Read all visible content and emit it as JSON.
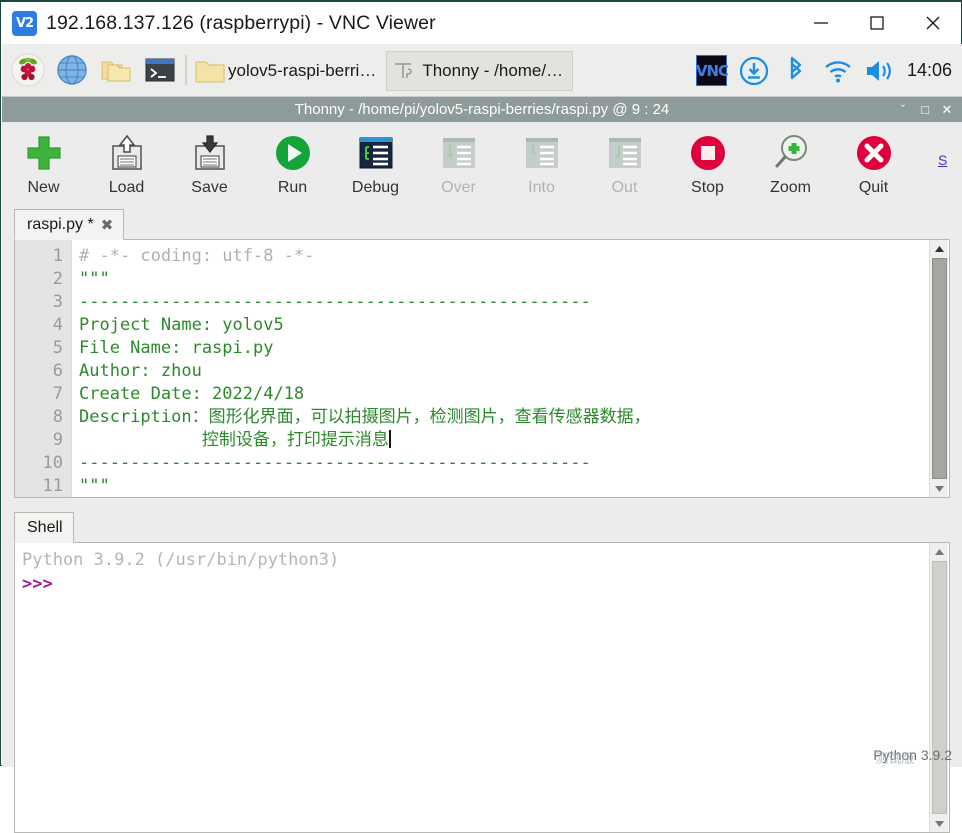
{
  "vnc": {
    "logo_text": "V2",
    "title": "192.168.137.126 (raspberrypi) - VNC Viewer",
    "window_buttons": [
      {
        "name": "minimize",
        "glyph": "—"
      },
      {
        "name": "maximize",
        "glyph": "□"
      },
      {
        "name": "close",
        "glyph": "✕"
      }
    ]
  },
  "taskbar": {
    "launchers": [
      {
        "name": "raspberry-menu-icon",
        "label": "Raspberry Pi Menu"
      },
      {
        "name": "web-browser-icon",
        "label": "Web Browser"
      },
      {
        "name": "file-manager-icon",
        "label": "File Manager"
      },
      {
        "name": "terminal-icon",
        "label": "Terminal"
      }
    ],
    "tasks": [
      {
        "name": "task-file-manager",
        "label": "yolov5-raspi-berri…",
        "icon": "folder-icon",
        "active": false
      },
      {
        "name": "task-thonny",
        "label": "Thonny  -  /home/…",
        "icon": "thonny-icon",
        "active": true
      }
    ],
    "tray": [
      {
        "name": "vnc-server-icon",
        "label": "VNC Server",
        "text": "VNC"
      },
      {
        "name": "update-icon",
        "label": "Updates Available"
      },
      {
        "name": "bluetooth-icon",
        "label": "Bluetooth"
      },
      {
        "name": "wifi-icon",
        "label": "Wireless Network"
      },
      {
        "name": "volume-icon",
        "label": "Volume"
      }
    ],
    "clock": "14:06"
  },
  "thonny": {
    "title": "Thonny  -  /home/pi/yolov5-raspi-berries/raspi.py  @  9 : 24",
    "window_buttons": [
      {
        "name": "shade",
        "glyph": "ˇ"
      },
      {
        "name": "maximize",
        "glyph": "□"
      },
      {
        "name": "close",
        "glyph": "✕"
      }
    ],
    "mode_link": "S",
    "toolbar": [
      {
        "name": "new-button",
        "label": "New",
        "icon": "plus-icon",
        "disabled": false
      },
      {
        "name": "load-button",
        "label": "Load",
        "icon": "floppy-up-icon",
        "disabled": false
      },
      {
        "name": "save-button",
        "label": "Save",
        "icon": "floppy-down-icon",
        "disabled": false
      },
      {
        "name": "run-button",
        "label": "Run",
        "icon": "play-icon",
        "disabled": false
      },
      {
        "name": "debug-button",
        "label": "Debug",
        "icon": "debug-icon",
        "disabled": false
      },
      {
        "name": "step-over-button",
        "label": "Over",
        "icon": "step-over-icon",
        "disabled": true
      },
      {
        "name": "step-into-button",
        "label": "Into",
        "icon": "step-into-icon",
        "disabled": true
      },
      {
        "name": "step-out-button",
        "label": "Out",
        "icon": "step-out-icon",
        "disabled": true
      },
      {
        "name": "stop-button",
        "label": "Stop",
        "icon": "stop-icon",
        "disabled": false
      },
      {
        "name": "zoom-button",
        "label": "Zoom",
        "icon": "magnifier-plus-icon",
        "disabled": false
      },
      {
        "name": "quit-button",
        "label": "Quit",
        "icon": "quit-x-icon",
        "disabled": false
      }
    ],
    "editor": {
      "tab_label": "raspi.py *",
      "tab_close_glyph": "✖",
      "line_numbers": [
        "1",
        "2",
        "3",
        "4",
        "5",
        "6",
        "7",
        "8",
        "9",
        "10",
        "11"
      ],
      "lines": [
        {
          "text": "# -*- coding: utf-8 -*-",
          "style": "comment"
        },
        {
          "text": "\"\"\"",
          "style": "string"
        },
        {
          "text": "",
          "style": "string"
        },
        {
          "text": "--------------------------------------------------",
          "style": "string"
        },
        {
          "text": "Project Name: yolov5",
          "style": "string"
        },
        {
          "text": "File Name: raspi.py",
          "style": "string"
        },
        {
          "text": "Author: zhou",
          "style": "string"
        },
        {
          "text": "Create Date: 2022/4/18",
          "style": "string"
        },
        {
          "text": "Description：图形化界面，可以拍摄图片，检测图片，查看传感器数据，",
          "style": "string"
        },
        {
          "text": "            控制设备，打印提示消息",
          "style": "string",
          "caret": true
        },
        {
          "text": "--------------------------------------------------",
          "style": "string"
        },
        {
          "text": "\"\"\"",
          "style": "string"
        }
      ]
    },
    "shell": {
      "tab_label": "Shell",
      "banner": "Python 3.9.2 (/usr/bin/python3)",
      "prompt": ">>>"
    },
    "statusbar": {
      "text": "Python 3.9.2",
      "watermark": "测试版"
    }
  },
  "colors": {
    "accent_green": "#2c8a2c",
    "accent_red": "#e0003c",
    "taskbar_bg": "#ededeb",
    "thonny_title_bg": "#8d9b9b",
    "thonny_bg": "#ececec",
    "prompt_purple": "#a01aa0"
  }
}
